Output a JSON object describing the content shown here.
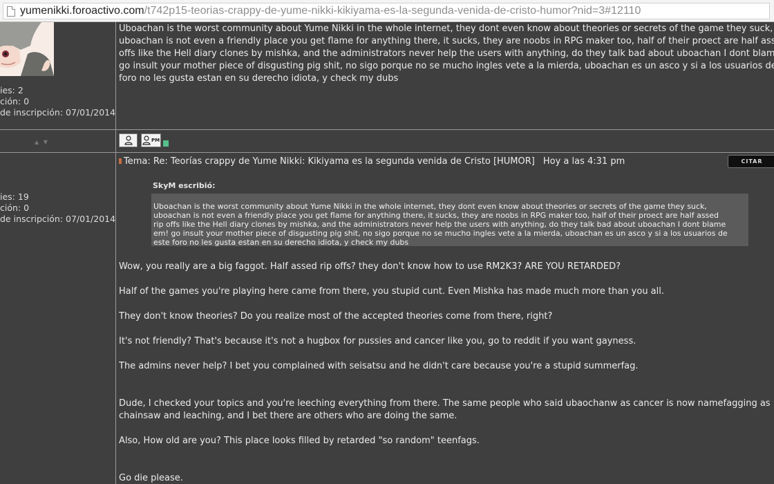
{
  "browser": {
    "url_domain": "yumenikki.foroactivo.com",
    "url_path": "/t742p15-teorias-crappy-de-yume-nikki-kikiyama-es-la-segunda-venida-de-cristo-humor?nid=3#12110"
  },
  "post1": {
    "stats": [
      "ies: 2",
      "ción: 0",
      "de inscripción: 07/01/2014"
    ],
    "lines": [
      "Uboachan is the worst community about Yume Nikki in the whole internet, they dont even know about theories or secrets of the game they suck,",
      "uboachan is not even a friendly place you get flame for anything there, it sucks, they are noobs in RPG maker too, half of their proect are half assed rip",
      "offs like the Hell diary clones by mishka, and the administrators never help the users with anything, do they talk bad about uboachan I dont blame em",
      "go insult your mother piece of disgusting pig shit, no sigo porque no se mucho ingles vete a la mierda, uboachan es un asco y si a los usuarios de este",
      "foro no les gusta estan en su derecho idiota, y check my dubs"
    ],
    "arrows": "▲ ▼",
    "pm_label": "PM"
  },
  "post2": {
    "stats": [
      "ies: 19",
      "ción: 0",
      "de inscripción: 07/01/2014"
    ],
    "title": "Tema: Re: Teorías crappy de Yume Nikki: Kikiyama es la segunda venida de Cristo [HUMOR]",
    "date": "Hoy a las 4:31 pm",
    "quote_button": "CITAR",
    "quote_author": "SkyM escribió:",
    "quote_lines": [
      "Uboachan is the worst community about Yume Nikki in the whole internet, they dont even know about theories or secrets of the game they suck,",
      "uboachan is not even a friendly place you get flame for anything there, it sucks, they are noobs in RPG maker too, half of their proect are half assed",
      "rip offs like the Hell diary clones by mishka, and the administrators never help the users with anything, do they talk bad about uboachan I dont blame",
      "em! go insult your mother piece of disgusting pig shit, no sigo porque no se mucho ingles vete a la mierda, uboachan es un asco y si a los usuarios de",
      "este foro no les gusta estan en su derecho idiota, y check my dubs"
    ],
    "reply_lines": [
      "Wow, you really are a big faggot. Half assed rip offs? they don't know how to use RM2K3? ARE YOU RETARDED?",
      "Half of the games you're playing here came from there, you stupid cunt. Even Mishka has made much more than you all.",
      "They don't know theories? Do you realize most of the accepted theories come from there, right?",
      "It's not friendly? That's because it's not a hugbox for pussies and cancer like you, go to reddit if you want gayness.",
      "The admins never help? I bet you complained with seisatsu and he didn't care because you're a stupid summerfag.",
      "Dude, I checked your topics and you're leeching everything from there. The same people who said ubaochanw as cancer is now namefagging as",
      "chainsaw and leaching, and I bet there are others who are doing the same.",
      "Also, How old are you? This place looks filled by retarded \"so random\" teenfags.",
      "Go die please."
    ]
  }
}
